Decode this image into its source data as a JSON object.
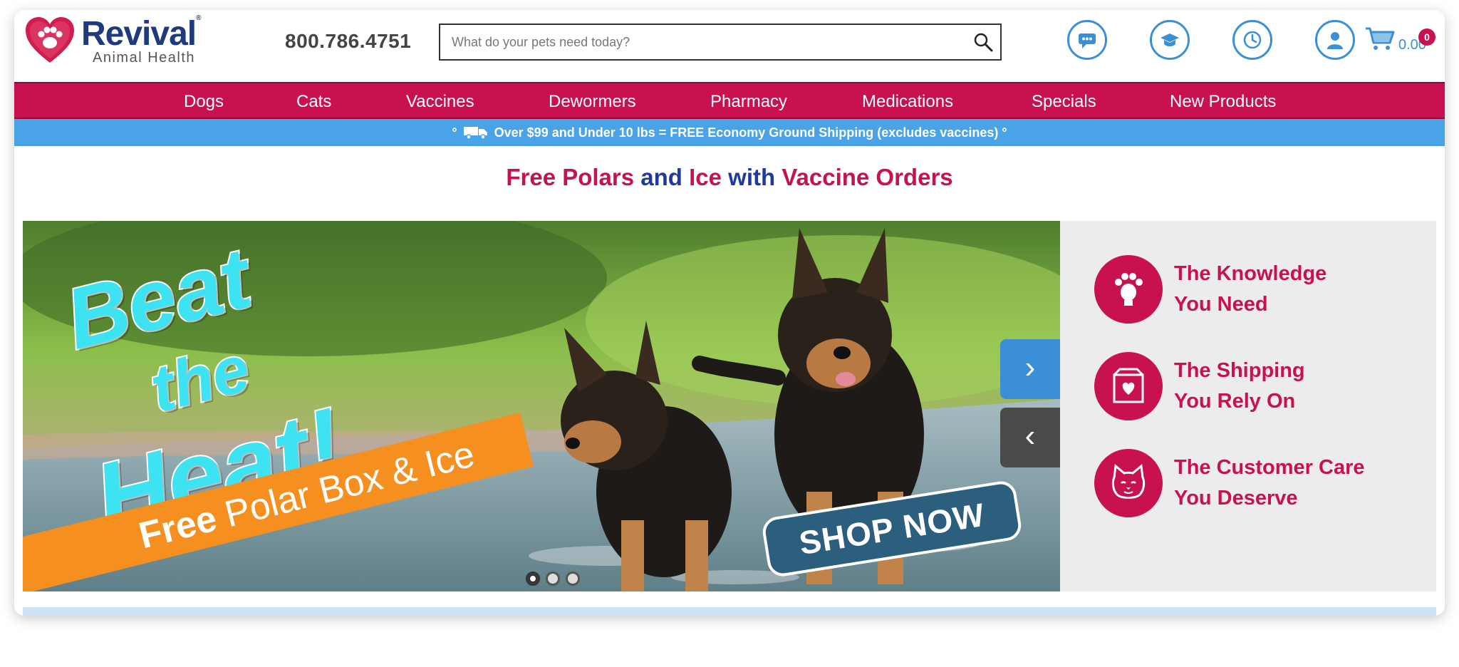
{
  "brand": {
    "name": "Revival",
    "tagline": "Animal Health",
    "registered": "®"
  },
  "header": {
    "phone": "800.786.4751",
    "search_placeholder": "What do your pets need today?",
    "icons": [
      "chat-icon",
      "graduation-cap-icon",
      "clock-icon",
      "user-icon"
    ],
    "cart": {
      "amount": "0.00",
      "count": "0"
    }
  },
  "nav": [
    "Dogs",
    "Cats",
    "Vaccines",
    "Dewormers",
    "Pharmacy",
    "Medications",
    "Specials",
    "New Products"
  ],
  "shipping": {
    "prefix": "°",
    "text": "Over $99 and Under 10 lbs = FREE Economy Ground Shipping (excludes vaccines)",
    "suffix": "°"
  },
  "promo": {
    "part1": "Free Polars",
    "part2": "and",
    "part3": "Ice",
    "part4": "with",
    "part5": "Vaccine Orders"
  },
  "hero": {
    "headline": [
      "Beat",
      "the",
      "Heat!"
    ],
    "banner_bold": "Free",
    "banner_rest": "Polar Box & Ice",
    "cta": "SHOP NOW",
    "next_arrow": "›",
    "prev_arrow": "‹",
    "slides": 3,
    "active_slide": 1
  },
  "features": [
    {
      "icon": "paw-lightbulb-icon",
      "line1": "The Knowledge",
      "line2": "You Need"
    },
    {
      "icon": "heart-box-icon",
      "line1": "The Shipping",
      "line2": "You Rely On"
    },
    {
      "icon": "cat-face-icon",
      "line1": "The Customer Care",
      "line2": "You Deserve"
    }
  ],
  "colors": {
    "primary": "#c8124f",
    "accent": "#3a8fd6",
    "ship_bar": "#4aa3e6",
    "brand_blue": "#1f3a7d",
    "banner_orange": "#f58f1f",
    "headline_cyan": "#3ee3f2"
  }
}
